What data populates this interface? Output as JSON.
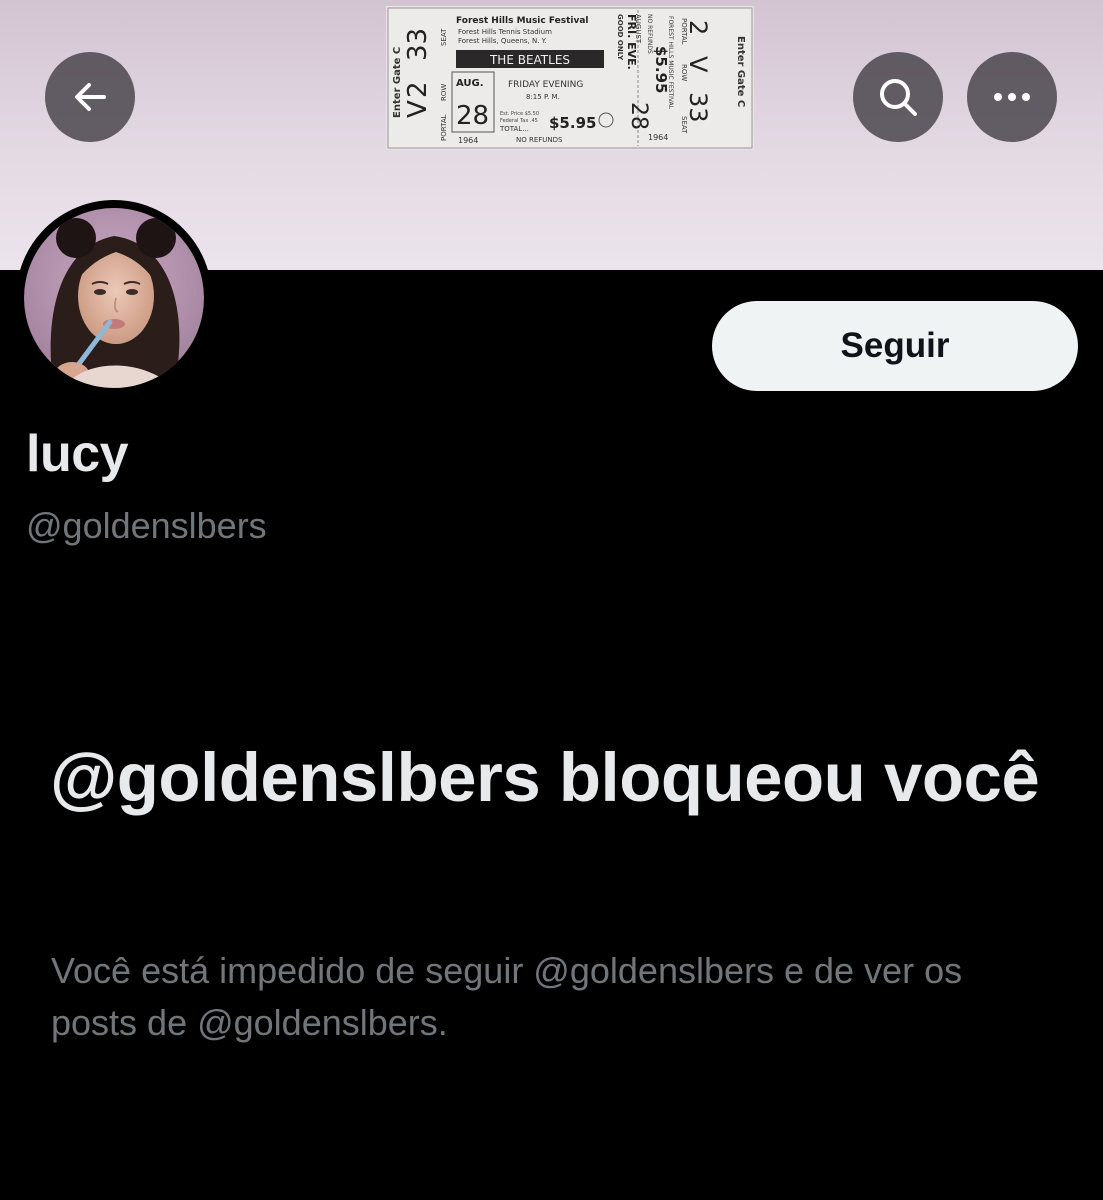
{
  "banner": {
    "ticket": {
      "festival": "Forest Hills Music Festival",
      "venue_line1": "Forest Hills Tennis Stadium",
      "venue_line2": "Forest Hills, Queens, N. Y.",
      "act": "THE BEATLES",
      "month": "AUG.",
      "day": "28",
      "evening": "FRIDAY EVENING",
      "time": "8:15 P. M.",
      "year": "1964",
      "price": "$5.95",
      "est_price": "Est. Price $5.50",
      "fed_tax": "Federal Tax .45",
      "total": "TOTAL...",
      "no_refunds": "NO REFUNDS",
      "gate": "Enter Gate C",
      "portal": "PORTAL",
      "row": "ROW",
      "seat": "SEAT",
      "portal_val": "2",
      "row_val": "V",
      "seat_val": "33",
      "stub_good": "GOOD ONLY",
      "stub_day": "FRI. EVE.",
      "stub_month": "AUGUST",
      "stub_refunds": "NO REFUNDS",
      "stub_festival": "FOREST HILLS MUSIC FESTIVAL"
    }
  },
  "nav": {
    "back_icon": "arrow-left-icon",
    "search_icon": "search-icon",
    "more_icon": "more-dots-icon"
  },
  "profile": {
    "display_name": "lucy",
    "handle": "@goldenslbers",
    "follow_label": "Seguir"
  },
  "blocked": {
    "title": "@goldenslbers bloqueou você",
    "description": "Você está impedido de seguir @goldenslbers e de ver os posts de @goldenslbers."
  },
  "colors": {
    "background": "#000000",
    "primary_text": "#e7e9ea",
    "secondary_text": "#71767b",
    "follow_button_bg": "#eff3f4",
    "banner_top": "#d2c4d1",
    "banner_bottom": "#ece4ec"
  }
}
